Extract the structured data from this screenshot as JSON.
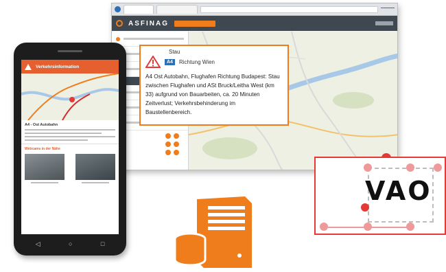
{
  "browser": {
    "brand": "ASFINAG",
    "popup": {
      "stau_label": "Stau",
      "road_badge": "A4",
      "direction": "Richtung Wien",
      "description": "A4 Ost Autobahn, Flughafen Richtung Budapest: Stau zwischen Flughafen und ASt Bruck/Leitha West (km 33) aufgrund von Bauarbeiten, ca. 20 Minuten Zeitverlust; Verkehrsbehinderung im Baustellenbereich."
    }
  },
  "phone": {
    "app_title": "Verkehrsinformation",
    "info_title": "A4 - Ost Autobahn",
    "cams_header": "Webcams in der Nähe",
    "nav": [
      "◁",
      "○",
      "□"
    ]
  },
  "vao": {
    "logo": "VAO"
  },
  "colors": {
    "asfinag_orange": "#f07d1b",
    "dark_bar": "#3f4750",
    "vao_red": "#e53935"
  }
}
